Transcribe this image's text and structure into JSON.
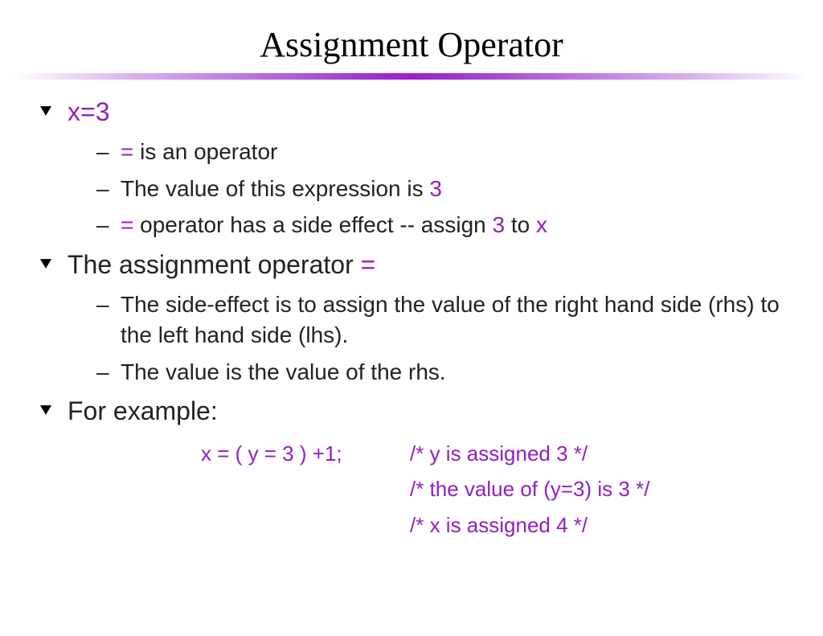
{
  "title": "Assignment Operator",
  "section1": {
    "heading": "x=3",
    "items": {
      "a_eq": "=",
      "a_rest": " is an operator",
      "b_pre": "The value of this expression is ",
      "b_val": "3",
      "c_eq": "=",
      "c_mid": " operator has a side effect -- assign ",
      "c_val": "3",
      "c_to": " to ",
      "c_var": "x"
    }
  },
  "section2": {
    "heading_pre": "The assignment operator ",
    "heading_eq": "=",
    "items": {
      "a": "The side-effect is to assign the value of the right hand side (rhs) to the left hand side (lhs).",
      "b": "The value is the value of the rhs."
    }
  },
  "section3": {
    "heading": "For example:",
    "code": {
      "expr": "x = ( y = 3 ) +1;",
      "comment1": "/* y is assigned 3 */",
      "comment2": "/* the value of (y=3) is 3 */",
      "comment3": "/* x is assigned 4 */"
    }
  }
}
